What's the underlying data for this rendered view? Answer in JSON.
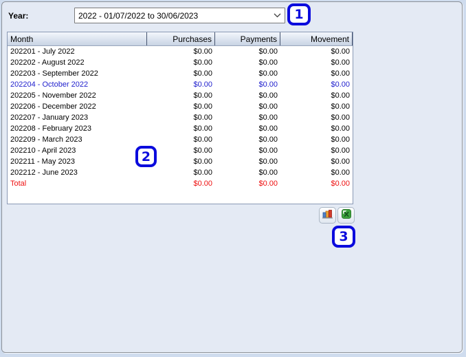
{
  "year_selector": {
    "label": "Year:",
    "selected_option": "2022 - 01/07/2022 to 30/06/2023"
  },
  "table": {
    "columns": [
      "Month",
      "Purchases",
      "Payments",
      "Movement"
    ],
    "rows": [
      {
        "month": "202201 - July 2022",
        "purchases": "$0.00",
        "payments": "$0.00",
        "movement": "$0.00"
      },
      {
        "month": "202202 - August 2022",
        "purchases": "$0.00",
        "payments": "$0.00",
        "movement": "$0.00"
      },
      {
        "month": "202203 - September 2022",
        "purchases": "$0.00",
        "payments": "$0.00",
        "movement": "$0.00"
      },
      {
        "month": "202204 - October 2022",
        "purchases": "$0.00",
        "payments": "$0.00",
        "movement": "$0.00"
      },
      {
        "month": "202205 - November 2022",
        "purchases": "$0.00",
        "payments": "$0.00",
        "movement": "$0.00"
      },
      {
        "month": "202206 - December 2022",
        "purchases": "$0.00",
        "payments": "$0.00",
        "movement": "$0.00"
      },
      {
        "month": "202207 - January 2023",
        "purchases": "$0.00",
        "payments": "$0.00",
        "movement": "$0.00"
      },
      {
        "month": "202208 - February 2023",
        "purchases": "$0.00",
        "payments": "$0.00",
        "movement": "$0.00"
      },
      {
        "month": "202209 - March 2023",
        "purchases": "$0.00",
        "payments": "$0.00",
        "movement": "$0.00"
      },
      {
        "month": "202210 - April 2023",
        "purchases": "$0.00",
        "payments": "$0.00",
        "movement": "$0.00"
      },
      {
        "month": "202211 - May 2023",
        "purchases": "$0.00",
        "payments": "$0.00",
        "movement": "$0.00"
      },
      {
        "month": "202212 - June 2023",
        "purchases": "$0.00",
        "payments": "$0.00",
        "movement": "$0.00"
      }
    ],
    "highlighted_row_month": "202204 - October 2022",
    "total": {
      "label": "Total",
      "purchases": "$0.00",
      "payments": "$0.00",
      "movement": "$0.00"
    }
  },
  "toolbar": {
    "icons": [
      "bar-chart-icon",
      "excel-export-icon"
    ]
  },
  "annotations": [
    {
      "number": "1"
    },
    {
      "number": "2"
    },
    {
      "number": "3"
    }
  ],
  "icon_names": {
    "dropdown": "chevron-down-icon",
    "chart": "bar-chart-icon",
    "excel": "excel-export-icon"
  },
  "colors": {
    "annotation_blue": "#0b0bdd",
    "highlighted_row_blue": "#2121cd",
    "total_red": "#ee0f0f",
    "panel_background": "#e4eaf4",
    "excel_green": "#3da23d",
    "chart_bar_blue": "#4f81c7",
    "chart_bar_orange": "#f0a030",
    "chart_bar_red": "#d03a2b"
  }
}
